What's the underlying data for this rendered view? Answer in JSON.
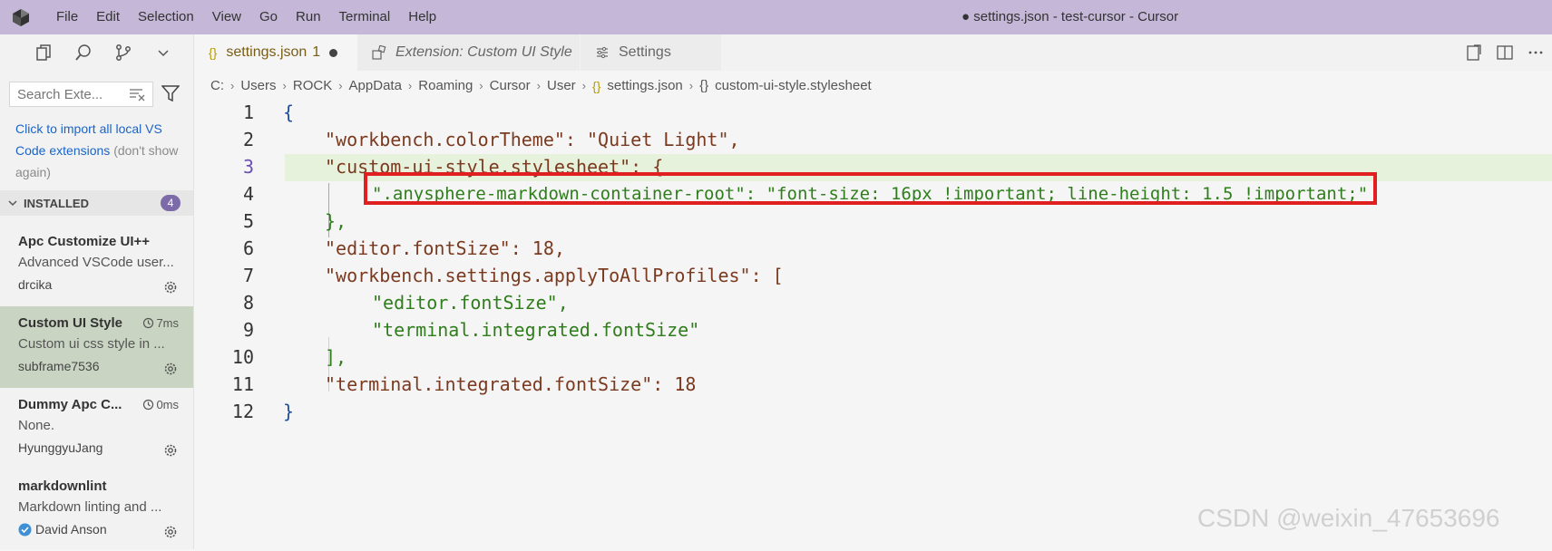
{
  "titlebar": {
    "menu": [
      "File",
      "Edit",
      "Selection",
      "View",
      "Go",
      "Run",
      "Terminal",
      "Help"
    ],
    "window_title": "● settings.json - test-cursor - Cursor",
    "bg_color": "#c4b7d7"
  },
  "sidebar": {
    "search_placeholder": "Search Exte...",
    "import_link": "Click to import all local VS Code extensions",
    "import_muted": "(don't show again)",
    "installed_label": "INSTALLED",
    "installed_count": "4",
    "extensions": [
      {
        "name": "Apc Customize UI++",
        "desc": "Advanced VSCode user...",
        "author": "drcika",
        "time": ""
      },
      {
        "name": "Custom UI Style",
        "desc": "Custom ui css style in ...",
        "author": "subframe7536",
        "time": "7ms"
      },
      {
        "name": "Dummy Apc C...",
        "desc": "None.",
        "author": "HyunggyuJang",
        "time": "0ms"
      },
      {
        "name": "markdownlint",
        "desc": "Markdown linting and ...",
        "author": "David Anson",
        "time": ""
      }
    ]
  },
  "tabs": [
    {
      "label": "settings.json",
      "suffix": "1",
      "icon": "json-braces-icon"
    },
    {
      "label": "Extension: Custom UI Style",
      "icon": "extension-icon"
    },
    {
      "label": "Settings",
      "icon": "settings-sliders-icon"
    }
  ],
  "breadcrumb": [
    "C:",
    "Users",
    "ROCK",
    "AppData",
    "Roaming",
    "Cursor",
    "User",
    "settings.json",
    "custom-ui-style.stylesheet"
  ],
  "editor": {
    "line_numbers": [
      "1",
      "2",
      "3",
      "4",
      "5",
      "6",
      "7",
      "8",
      "9",
      "10",
      "11",
      "12"
    ],
    "lines": [
      "{",
      "\"workbench.colorTheme\": \"Quiet Light\",",
      "\"custom-ui-style.stylesheet\": {",
      "\".anysphere-markdown-container-root\": \"font-size: 16px !important; line-height: 1.5 !important;\"",
      "},",
      "\"editor.fontSize\": 18,",
      "\"workbench.settings.applyToAllProfiles\": [",
      "\"editor.fontSize\",",
      "\"terminal.integrated.fontSize\"",
      "],",
      "\"terminal.integrated.fontSize\": 18",
      "}"
    ]
  },
  "watermark": "CSDN @weixin_47653696",
  "colors": {
    "highlight_box": "#e02020",
    "selected_ext": "#c9d5c2"
  }
}
